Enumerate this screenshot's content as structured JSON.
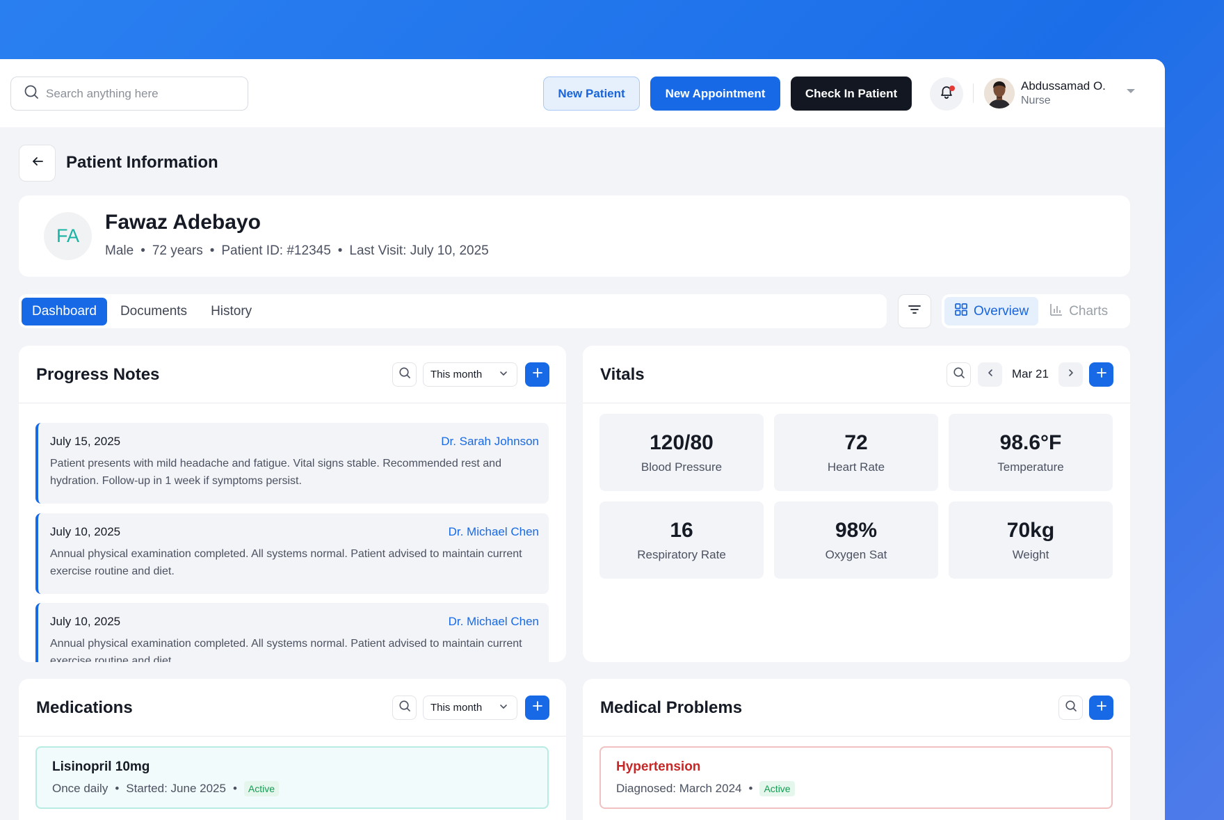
{
  "topbar": {
    "search_placeholder": "Search anything here",
    "new_patient": "New Patient",
    "new_appointment": "New Appointment",
    "check_in": "Check In Patient",
    "user_name": "Abdussamad O.",
    "user_role": "Nurse"
  },
  "page": {
    "title": "Patient Information"
  },
  "patient": {
    "initials": "FA",
    "name": "Fawaz Adebayo",
    "gender": "Male",
    "age": "72 years",
    "patient_id": "Patient ID: #12345",
    "last_visit": "Last Visit: July 10, 2025"
  },
  "tabs": [
    "Dashboard",
    "Documents",
    "History"
  ],
  "view_toggle": {
    "overview": "Overview",
    "charts": "Charts"
  },
  "progress_notes": {
    "title": "Progress Notes",
    "filter": "This month",
    "notes": [
      {
        "date": "July 15, 2025",
        "doctor": "Dr. Sarah Johnson",
        "text": "Patient presents with mild headache and fatigue. Vital signs stable. Recommended rest and hydration. Follow-up in 1 week if symptoms persist."
      },
      {
        "date": "July 10, 2025",
        "doctor": "Dr. Michael Chen",
        "text": "Annual physical examination completed. All systems normal. Patient advised to maintain current exercise routine and diet."
      },
      {
        "date": "July 10, 2025",
        "doctor": "Dr. Michael Chen",
        "text": "Annual physical examination completed. All systems normal. Patient advised to maintain current exercise routine and diet."
      }
    ]
  },
  "vitals": {
    "title": "Vitals",
    "date": "Mar 21",
    "items": [
      {
        "value": "120/80",
        "label": "Blood Pressure"
      },
      {
        "value": "72",
        "label": "Heart Rate"
      },
      {
        "value": "98.6°F",
        "label": "Temperature"
      },
      {
        "value": "16",
        "label": "Respiratory Rate"
      },
      {
        "value": "98%",
        "label": "Oxygen Sat"
      },
      {
        "value": "70kg",
        "label": "Weight"
      }
    ]
  },
  "medications": {
    "title": "Medications",
    "filter": "This month",
    "items": [
      {
        "name": "Lisinopril 10mg",
        "frequency": "Once daily",
        "started": "Started: June 2025",
        "status": "Active"
      }
    ]
  },
  "medical_problems": {
    "title": "Medical Problems",
    "items": [
      {
        "name": "Hypertension",
        "diagnosed": "Diagnosed: March 2024",
        "status": "Active"
      }
    ]
  },
  "colors": {
    "primary": "#1769e6",
    "dark_button": "#121722",
    "active_badge": "#159a52",
    "problem_title": "#c62828",
    "initials": "#19b3a4"
  }
}
